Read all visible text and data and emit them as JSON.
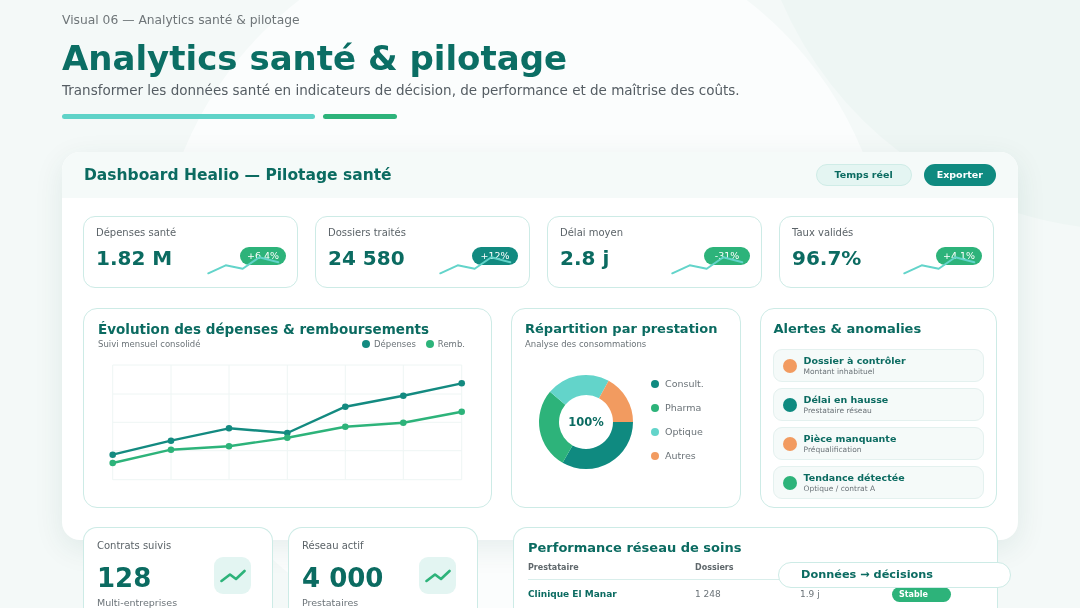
{
  "caption": "Visual 06 — Analytics santé & pilotage",
  "header": {
    "title": "Analytics santé & pilotage",
    "subtitle": "Transformer les données santé en indicateurs de décision, de performance et de maîtrise des coûts."
  },
  "dashboard": {
    "title": "Dashboard Healio — Pilotage santé",
    "buttons": [
      {
        "label": "Temps réel",
        "kind": "secondary"
      },
      {
        "label": "Exporter",
        "kind": "primary"
      }
    ]
  },
  "kpis": [
    {
      "label": "Dépenses santé",
      "value": "1.82 M",
      "badge": {
        "text": "+6.4%",
        "color": "#2db37a"
      }
    },
    {
      "label": "Dossiers traités",
      "value": "24 580",
      "badge": {
        "text": "+12%",
        "color": "#128a80"
      }
    },
    {
      "label": "Délai moyen",
      "value": "2.8 j",
      "badge": {
        "text": "-31%",
        "color": "#2db37a"
      }
    },
    {
      "label": "Taux validés",
      "value": "96.7%",
      "badge": {
        "text": "+4.1%",
        "color": "#2db37a"
      }
    }
  ],
  "trend_chart": {
    "title": "Évolution des dépenses & remboursements",
    "subtitle": "Suivi mensuel consolidé",
    "legend": [
      {
        "name": "Dépenses",
        "color": "#138a80"
      },
      {
        "name": "Remb.",
        "color": "#2db37a"
      }
    ]
  },
  "distribution": {
    "title": "Répartition par prestation",
    "subtitle": "Analyse des consommations",
    "center_label": "100%",
    "legend": [
      {
        "name": "Consult.",
        "color": "#0f8a80"
      },
      {
        "name": "Pharma",
        "color": "#2db37a"
      },
      {
        "name": "Optique",
        "color": "#63d4ca"
      },
      {
        "name": "Autres",
        "color": "#f29b60"
      }
    ]
  },
  "alerts": {
    "title": "Alertes & anomalies",
    "items": [
      {
        "title": "Dossier à contrôler",
        "detail": "Montant inhabituel",
        "color": "#f29b60"
      },
      {
        "title": "Délai en hausse",
        "detail": "Prestataire réseau",
        "color": "#0f8a80"
      },
      {
        "title": "Pièce manquante",
        "detail": "Préqualification",
        "color": "#f29b60"
      },
      {
        "title": "Tendance détectée",
        "detail": "Optique / contrat A",
        "color": "#2db37a"
      }
    ]
  },
  "summary_cards": [
    {
      "label": "Contrats suivis",
      "value": "128",
      "caption": "Multi-entreprises"
    },
    {
      "label": "Réseau actif",
      "value": "4 000",
      "caption": "Prestataires"
    }
  ],
  "network_table": {
    "title": "Performance réseau de soins",
    "columns": [
      "Prestataire",
      "Dossiers"
    ],
    "rows": [
      {
        "cells": [
          "Clinique El Manar",
          "1 248",
          "1.9 j"
        ],
        "status": "Stable"
      }
    ]
  },
  "highlight_pill": {
    "text": "Données → décisions"
  }
}
